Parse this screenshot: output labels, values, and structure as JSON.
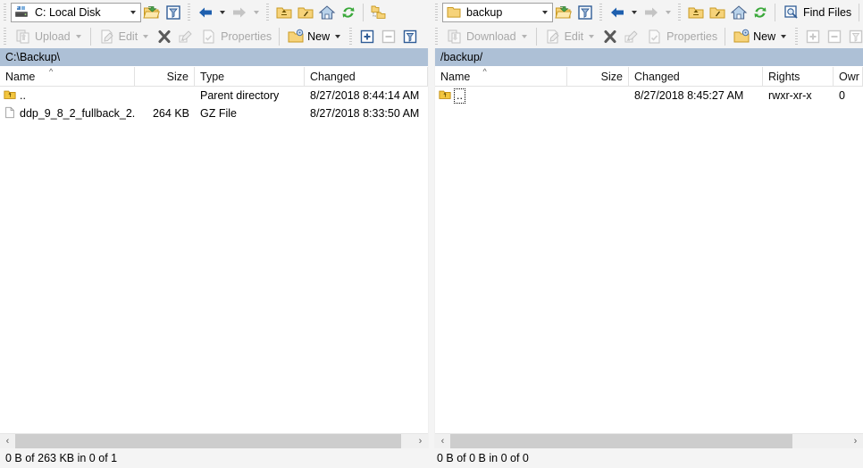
{
  "left_toolbar": {
    "path_value": "C: Local Disk",
    "path_icon": "local-disk-icon",
    "buttons": [
      {
        "name": "open-directory-bookmark",
        "icon": "open-folder-green-arrow-icon",
        "label": ""
      },
      {
        "name": "filter-mask",
        "icon": "funnel-filter-icon",
        "label": ""
      },
      {
        "name": "back",
        "icon": "back-arrow-icon",
        "label": ""
      },
      {
        "name": "forward",
        "icon": "forward-arrow-icon",
        "label": ""
      },
      {
        "name": "parent-directory",
        "icon": "folder-up-icon",
        "label": ""
      },
      {
        "name": "root-directory",
        "icon": "folder-root-icon",
        "label": ""
      },
      {
        "name": "home-directory",
        "icon": "home-icon",
        "label": ""
      },
      {
        "name": "refresh",
        "icon": "refresh-icon",
        "label": ""
      },
      {
        "name": "directory-tree",
        "icon": "folder-tree-icon",
        "label": ""
      }
    ]
  },
  "right_toolbar": {
    "path_value": "backup",
    "path_icon": "remote-folder-icon",
    "find_files_label": "Find Files",
    "buttons": [
      {
        "name": "open-directory-bookmark",
        "icon": "open-folder-green-arrow-icon",
        "label": ""
      },
      {
        "name": "filter-mask",
        "icon": "funnel-filter-icon",
        "label": ""
      },
      {
        "name": "back",
        "icon": "back-arrow-icon",
        "label": ""
      },
      {
        "name": "forward",
        "icon": "forward-arrow-icon",
        "label": ""
      },
      {
        "name": "parent-directory",
        "icon": "folder-up-icon",
        "label": ""
      },
      {
        "name": "root-directory",
        "icon": "folder-root-icon",
        "label": ""
      },
      {
        "name": "home-directory",
        "icon": "home-icon",
        "label": ""
      },
      {
        "name": "refresh",
        "icon": "refresh-icon",
        "label": ""
      },
      {
        "name": "find-files",
        "icon": "find-files-icon",
        "label": "Find Files"
      },
      {
        "name": "directory-tree",
        "icon": "folder-tree-icon",
        "label": ""
      }
    ]
  },
  "left_actions": {
    "transfer_label": "Upload",
    "edit_label": "Edit",
    "properties_label": "Properties",
    "new_label": "New",
    "delete_icon": "delete-x-icon",
    "rename_icon": "rename-icon",
    "select_add_icon": "select-plus-icon",
    "select_remove_icon": "select-minus-icon",
    "select_filter_icon": "select-filter-icon"
  },
  "right_actions": {
    "transfer_label": "Download",
    "edit_label": "Edit",
    "properties_label": "Properties",
    "new_label": "New",
    "delete_icon": "delete-x-icon",
    "rename_icon": "rename-icon",
    "select_add_icon": "select-plus-icon",
    "select_remove_icon": "select-minus-icon",
    "select_filter_icon": "select-filter-icon"
  },
  "left_pane": {
    "path": "C:\\Backup\\",
    "columns": [
      "Name",
      "Size",
      "Type",
      "Changed"
    ],
    "sort_column": "Name",
    "sort_direction": "ascending",
    "rows": [
      {
        "icon": "parent-folder-icon",
        "name": "..",
        "size": "",
        "type": "Parent directory",
        "changed": "8/27/2018  8:44:14 AM"
      },
      {
        "icon": "file-icon",
        "name": "ddp_9_8_2_fullback_2...",
        "size": "264 KB",
        "type": "GZ File",
        "changed": "8/27/2018  8:33:50 AM"
      }
    ],
    "status": "0 B of 263 KB in 0 of 1",
    "scroll_left_glyph": "‹",
    "scroll_right_glyph": "›"
  },
  "right_pane": {
    "path": "/backup/",
    "columns": [
      "Name",
      "Size",
      "Changed",
      "Rights",
      "Owr"
    ],
    "sort_column": "Name",
    "sort_direction": "ascending",
    "rows": [
      {
        "icon": "parent-folder-icon",
        "name": "..",
        "size": "",
        "changed": "8/27/2018  8:45:27 AM",
        "rights": "rwxr-xr-x",
        "owner": "0",
        "focused": true
      }
    ],
    "status": "0 B of 0 B in 0 of 0",
    "scroll_left_glyph": "‹",
    "scroll_right_glyph": "›"
  },
  "colors": {
    "pathbar_bg": "#adc0d6",
    "toolbar_bg": "#f4f4f4",
    "list_bg": "#ffffff",
    "disabled_text": "#a8a8a8",
    "folder_yellow": "#f2c14e",
    "accent_blue": "#1e5fae",
    "refresh_green": "#3aa83a"
  }
}
